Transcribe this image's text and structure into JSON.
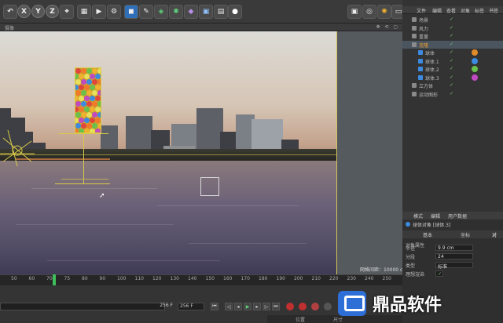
{
  "toolbar": {
    "axis_buttons": [
      "X",
      "Y",
      "Z"
    ],
    "icons": [
      "coord-icon",
      "render-region-icon",
      "render-view-icon",
      "render-settings-icon",
      "cube-icon",
      "pen-icon",
      "subdivide-icon",
      "array-icon",
      "deformer-icon",
      "camera-icon",
      "scene-icon",
      "light-icon"
    ],
    "right_icons": [
      "display-icon",
      "target-icon",
      "sun-icon",
      "layout-icon"
    ]
  },
  "viewport": {
    "header_label": "摄像",
    "info_text": "网格间距：10000 cm"
  },
  "object_manager": {
    "menu": [
      "文件",
      "编辑",
      "查看",
      "对象",
      "标签",
      "书签"
    ],
    "items": [
      {
        "label": "场景",
        "indent": 0,
        "tag": ""
      },
      {
        "label": "风力",
        "indent": 0,
        "tag": ""
      },
      {
        "label": "重量",
        "indent": 0,
        "tag": ""
      },
      {
        "label": "克隆",
        "indent": 0,
        "tag": "",
        "selected": true
      },
      {
        "label": "球体",
        "indent": 1,
        "tag": "#e08a2a"
      },
      {
        "label": "球体.1",
        "indent": 1,
        "tag": "#3c8be0"
      },
      {
        "label": "球体.2",
        "indent": 1,
        "tag": "#6ac04a"
      },
      {
        "label": "球体.3",
        "indent": 1,
        "tag": "#c04ac0"
      },
      {
        "label": "立方体",
        "indent": 0,
        "tag": ""
      },
      {
        "label": "运动图形",
        "indent": 0,
        "tag": ""
      }
    ]
  },
  "attribute_manager": {
    "menu": [
      "模式",
      "编辑",
      "用户数据"
    ],
    "title": "球体对象 [球体.3]",
    "tabs": [
      "基本",
      "坐标",
      "对"
    ],
    "section": "对象属性",
    "fields": [
      {
        "label": "半径",
        "value": "9.9 cm"
      },
      {
        "label": "分段",
        "value": "24"
      },
      {
        "label": "类型",
        "value": "标准"
      },
      {
        "label": "理想渲染",
        "value": "✓"
      }
    ]
  },
  "timeline": {
    "ticks": [
      "50",
      "60",
      "70",
      "75",
      "80",
      "90",
      "100",
      "110",
      "120",
      "130",
      "140",
      "150",
      "160",
      "170",
      "180",
      "190",
      "200",
      "210",
      "220",
      "230",
      "240",
      "250"
    ],
    "current_frame": "73",
    "start_field": "256 F",
    "end_field": "256 F",
    "position_label": "位置",
    "size_label": "尺寸"
  },
  "watermark": {
    "text": "鼎品软件"
  }
}
